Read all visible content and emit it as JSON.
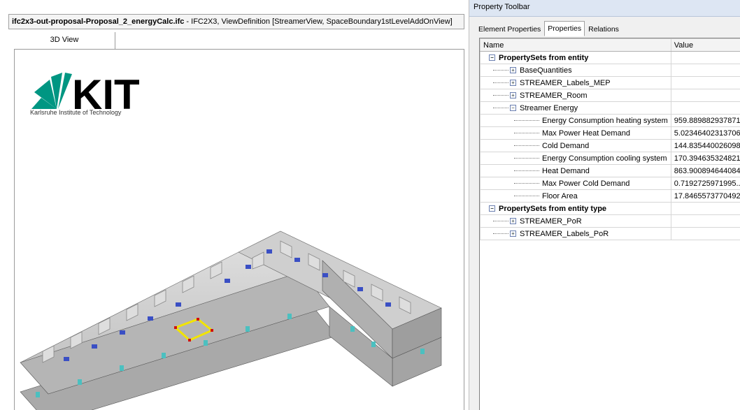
{
  "viewer": {
    "title_bold": "ifc2x3-out-proposal-Proposal_2_energyCalc.ifc",
    "title_rest": " - IFC2X3, ViewDefinition [StreamerView, SpaceBoundary1stLevelAddOnView]",
    "tab_label": "3D View",
    "logo_text": "KIT",
    "logo_caption": "Karlsruhe Institute of Technology"
  },
  "toolbar": {
    "title": "Property Toolbar",
    "tabs": [
      {
        "label": "Element Properties",
        "active": false
      },
      {
        "label": "Properties",
        "active": true
      },
      {
        "label": "Relations",
        "active": false
      }
    ],
    "columns": {
      "name": "Name",
      "value": "Value"
    },
    "rows": [
      {
        "label": "PropertySets from entity",
        "value": "",
        "level": 0,
        "expander": "−",
        "bold": true
      },
      {
        "label": "BaseQuantities",
        "value": "",
        "level": 1,
        "expander": "+"
      },
      {
        "label": "STREAMER_Labels_MEP",
        "value": "",
        "level": 1,
        "expander": "+"
      },
      {
        "label": "STREAMER_Room",
        "value": "",
        "level": 1,
        "expander": "+"
      },
      {
        "label": "Streamer Energy",
        "value": "",
        "level": 1,
        "expander": "−"
      },
      {
        "label": "Energy Consumption heating system",
        "value": "959.889882937871",
        "level": 2
      },
      {
        "label": "Max Power Heat Demand",
        "value": "5.02346402313706",
        "level": 2
      },
      {
        "label": "Cold Demand",
        "value": "144.835440026098",
        "level": 2
      },
      {
        "label": "Energy Consumption cooling system",
        "value": "170.394635324821",
        "level": 2
      },
      {
        "label": "Heat Demand",
        "value": "863.900894644084",
        "level": 2
      },
      {
        "label": "Max Power Cold Demand",
        "value": "0.7192725971995...",
        "level": 2
      },
      {
        "label": "Floor Area",
        "value": "17.8465573770492",
        "level": 2
      },
      {
        "label": "PropertySets from entity type",
        "value": "",
        "level": 0,
        "expander": "−",
        "bold": true
      },
      {
        "label": "STREAMER_PoR",
        "value": "",
        "level": 1,
        "expander": "+"
      },
      {
        "label": "STREAMER_Labels_PoR",
        "value": "",
        "level": 1,
        "expander": "+"
      }
    ]
  },
  "colors": {
    "kit_green": "#009682",
    "building_gray": "#c8c8c8",
    "window_blue": "#3a4fc4",
    "selection_yellow": "#f2e400",
    "selection_red": "#d01010"
  }
}
